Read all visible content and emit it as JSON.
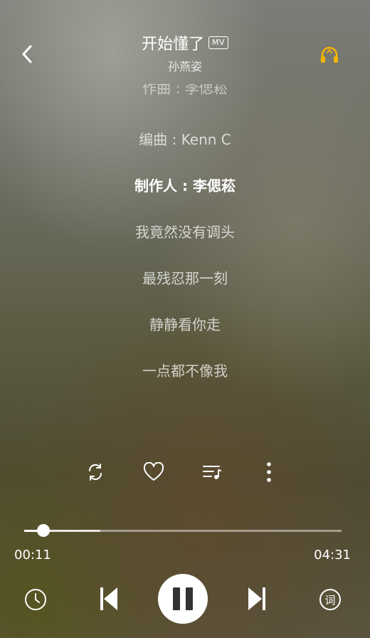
{
  "header": {
    "song_title": "开始懂了",
    "mv_badge": "MV",
    "artist": "孙燕姿"
  },
  "lyrics": {
    "partial_line": "作曲 : 李偲菘",
    "lines": [
      "编曲 : Kenn C",
      "制作人 : 李偲菘",
      "我竟然没有调头",
      "最残忍那一刻",
      "静静看你走",
      "一点都不像我"
    ],
    "current_index": 1
  },
  "player": {
    "current_time": "00:11",
    "total_time": "04:31",
    "progress": 0.06,
    "buffered": 0.24
  },
  "icons": {
    "back": "chevron-left-icon",
    "headset": "headphones-icon",
    "repeat": "repeat-icon",
    "favorite": "heart-icon",
    "queue": "playlist-icon",
    "more": "more-vertical-icon",
    "history": "clock-icon",
    "prev": "skip-previous-icon",
    "play_pause": "pause-icon",
    "next": "skip-next-icon",
    "lyrics_toggle": "lyrics-icon"
  },
  "colors": {
    "headset_accent": "#f5b400"
  }
}
